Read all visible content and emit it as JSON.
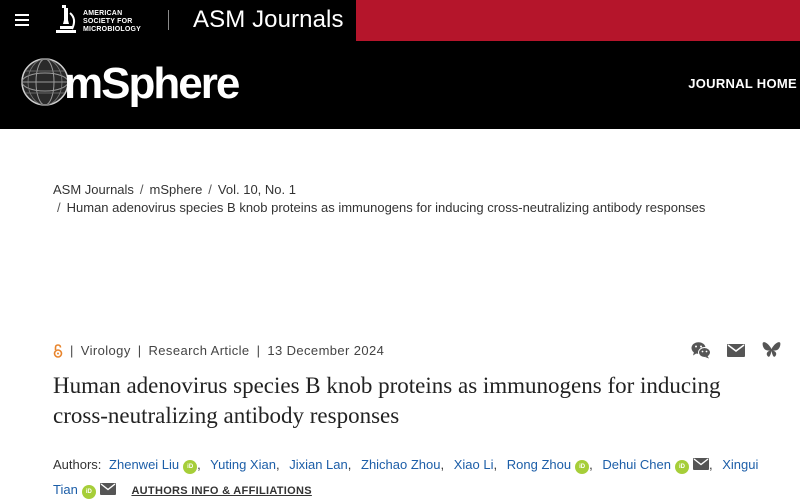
{
  "topbar": {
    "org_line1": "AMERICAN",
    "org_line2": "SOCIETY FOR",
    "org_line3": "MICROBIOLOGY",
    "journals_title": "ASM Journals",
    "accent_color": "#b5152b"
  },
  "journal": {
    "logo_text": "mSphere",
    "home_label": "JOURNAL HOME"
  },
  "breadcrumb": {
    "items": [
      "ASM Journals",
      "mSphere",
      "Vol. 10, No. 1"
    ],
    "current": "Human adenovirus species B knob proteins as immunogens for inducing cross-neutralizing antibody responses"
  },
  "article": {
    "section": "Virology",
    "type": "Research Article",
    "date": "13 December 2024",
    "title": "Human adenovirus species B knob proteins as immunogens for inducing cross-neutralizing antibody responses",
    "authors_label": "Authors:",
    "authors": [
      {
        "name": "Zhenwei Liu",
        "orcid": true,
        "email": false
      },
      {
        "name": "Yuting Xian",
        "orcid": false,
        "email": false
      },
      {
        "name": "Jixian Lan",
        "orcid": false,
        "email": false
      },
      {
        "name": "Zhichao Zhou",
        "orcid": false,
        "email": false
      },
      {
        "name": "Xiao Li",
        "orcid": false,
        "email": false
      },
      {
        "name": "Rong Zhou",
        "orcid": true,
        "email": false
      },
      {
        "name": "Dehui Chen",
        "orcid": true,
        "email": true
      },
      {
        "name": "Xingui Tian",
        "orcid": true,
        "email": true
      }
    ],
    "affiliations_label": "AUTHORS INFO & AFFILIATIONS",
    "orcid_badge": "iD"
  },
  "share_icons": [
    "wechat-icon",
    "email-icon",
    "bluesky-icon"
  ]
}
